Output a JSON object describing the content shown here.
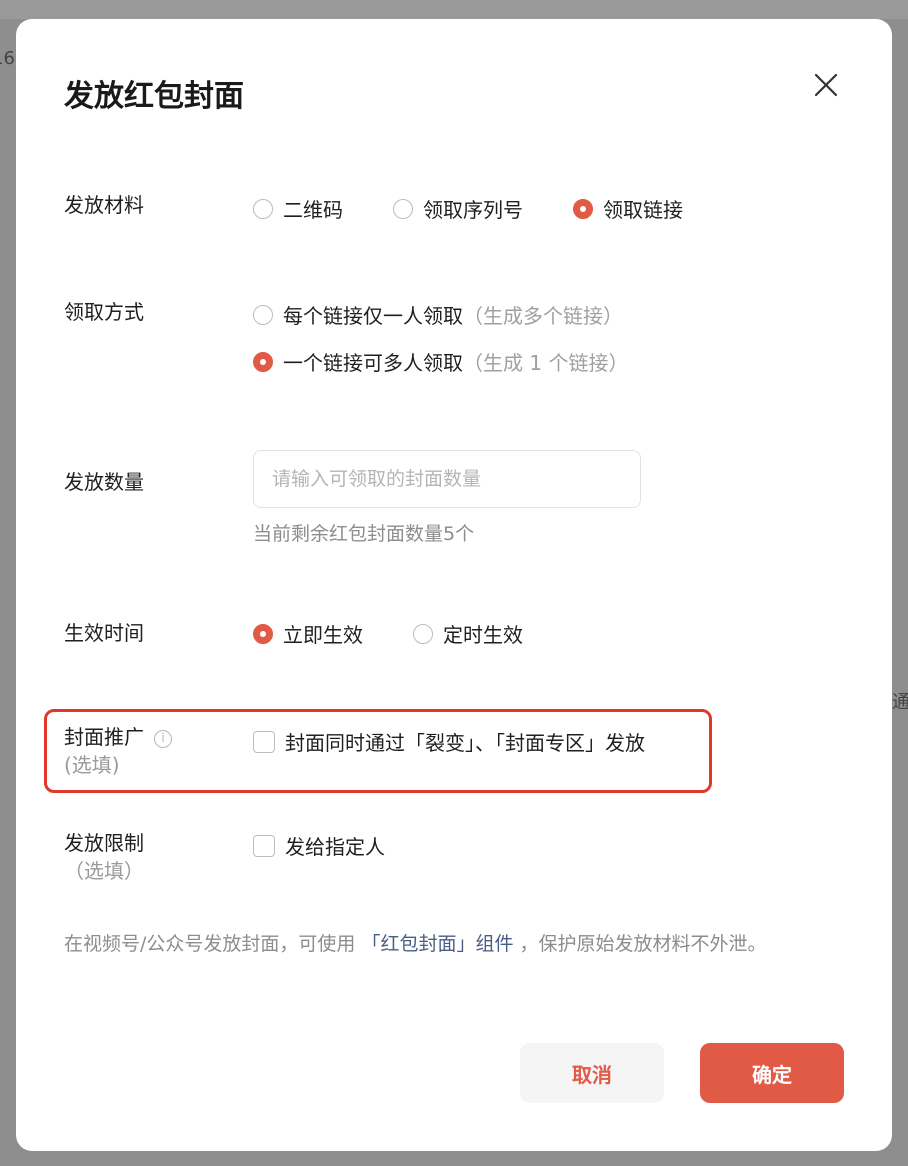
{
  "background": {
    "edge_text_left": "16",
    "edge_text_right": "通"
  },
  "dialog": {
    "title": "发放红包封面",
    "close_icon": "close-icon",
    "material": {
      "label": "发放材料",
      "options": [
        "二维码",
        "领取序列号",
        "领取链接"
      ],
      "selected": "领取链接"
    },
    "claim_method": {
      "label": "领取方式",
      "options": [
        {
          "text": "每个链接仅一人领取",
          "hint": "（生成多个链接）"
        },
        {
          "text": "一个链接可多人领取",
          "hint": "（生成 1 个链接）"
        }
      ],
      "selected": "一个链接可多人领取"
    },
    "quantity": {
      "label": "发放数量",
      "placeholder": "请输入可领取的封面数量",
      "value": "",
      "remaining": "当前剩余红包封面数量5个"
    },
    "effective_time": {
      "label": "生效时间",
      "options": [
        "立即生效",
        "定时生效"
      ],
      "selected": "立即生效"
    },
    "promotion": {
      "label": "封面推广",
      "optional": "(选填)",
      "info_icon": "info-icon",
      "checkbox_label": "封面同时通过「裂变」、「封面专区」发放",
      "checked": false
    },
    "restriction": {
      "label": "发放限制",
      "optional": "（选填）",
      "checkbox_label": "发给指定人",
      "checked": false
    },
    "note": {
      "prefix": "在视频号/公众号发放封面，可使用",
      "link": "「红包封面」组件",
      "suffix": "，保护原始发放材料不外泄。"
    },
    "buttons": {
      "cancel": "取消",
      "confirm": "确定"
    }
  },
  "colors": {
    "accent": "#e15a46",
    "highlight_border": "#e0392b",
    "link": "#4a5d86"
  }
}
